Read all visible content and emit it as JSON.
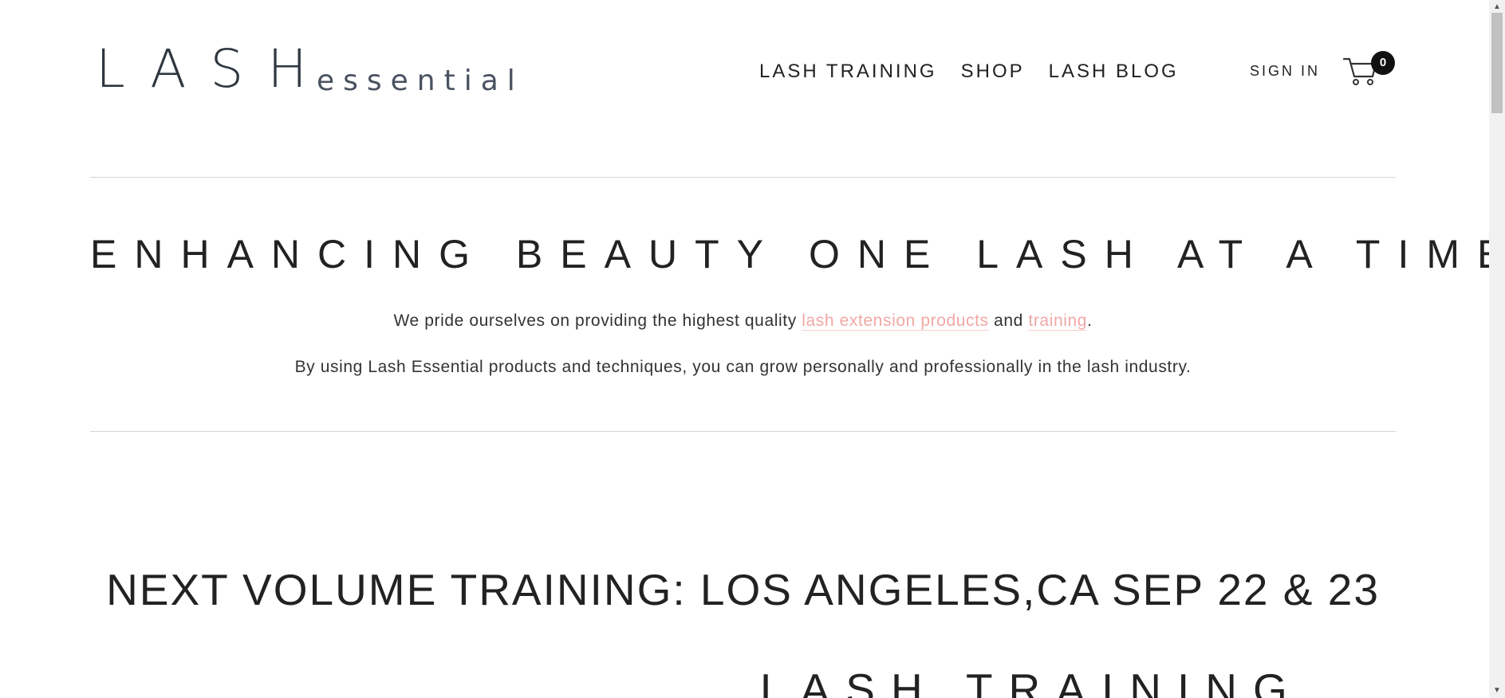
{
  "header": {
    "logo": {
      "main": "LASH",
      "sub": "essential"
    },
    "nav": [
      {
        "label": "LASH TRAINING"
      },
      {
        "label": "SHOP"
      },
      {
        "label": "LASH BLOG"
      }
    ],
    "sign_in": "SIGN IN",
    "cart_count": "0"
  },
  "hero": {
    "title": "ENHANCING BEAUTY ONE LASH AT A TIME",
    "line1": {
      "prefix": "We pride ourselves on providing the highest quality ",
      "link1": "lash extension products",
      "middle": " and ",
      "link2": "training",
      "suffix": "."
    },
    "line2": "By using Lash Essential products and techniques, you can grow personally and professionally in the lash industry."
  },
  "next_training": {
    "title": "NEXT VOLUME TRAINING: LOS ANGELES,CA SEP 22 & 23"
  },
  "section": {
    "title": "LASH TRAINING"
  },
  "colors": {
    "link": "#f0a8a4",
    "text": "#222222",
    "divider": "#d5d5d5",
    "badge": "#111111"
  }
}
